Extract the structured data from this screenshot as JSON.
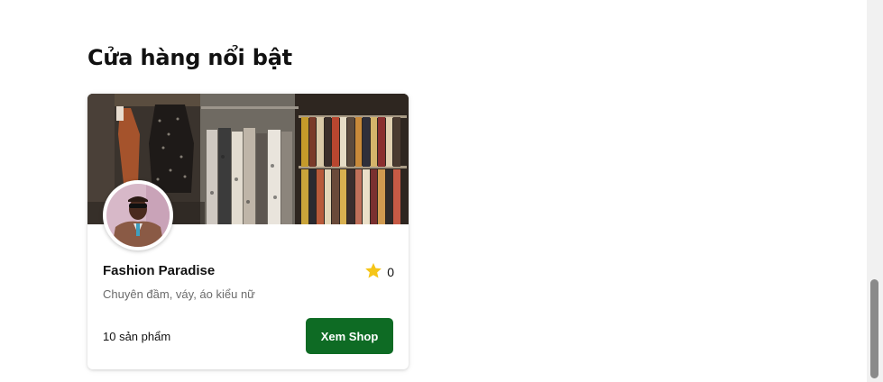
{
  "section": {
    "title": "Cửa hàng nổi bật"
  },
  "store": {
    "name": "Fashion Paradise",
    "description": "Chuyên đầm, váy, áo kiểu nữ",
    "rating": "0",
    "product_count": "10 sản phẩm",
    "button_label": "Xem Shop",
    "cover_image": "clothing-rack-photo",
    "avatar_image": "shop-owner-portrait"
  },
  "icons": {
    "rating": "star-icon"
  },
  "colors": {
    "button_bg": "#0e6b24",
    "button_text": "#ffffff",
    "star": "#f5c518",
    "description_text": "#6b6b6b"
  }
}
